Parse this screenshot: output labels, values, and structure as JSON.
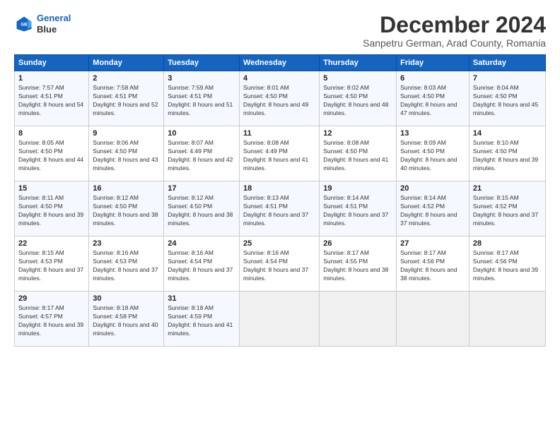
{
  "logo": {
    "line1": "General",
    "line2": "Blue"
  },
  "title": "December 2024",
  "subtitle": "Sanpetru German, Arad County, Romania",
  "headers": [
    "Sunday",
    "Monday",
    "Tuesday",
    "Wednesday",
    "Thursday",
    "Friday",
    "Saturday"
  ],
  "weeks": [
    [
      {
        "day": "1",
        "sunrise": "7:57 AM",
        "sunset": "4:51 PM",
        "daylight": "8 hours and 54 minutes."
      },
      {
        "day": "2",
        "sunrise": "7:58 AM",
        "sunset": "4:51 PM",
        "daylight": "8 hours and 52 minutes."
      },
      {
        "day": "3",
        "sunrise": "7:59 AM",
        "sunset": "4:51 PM",
        "daylight": "8 hours and 51 minutes."
      },
      {
        "day": "4",
        "sunrise": "8:01 AM",
        "sunset": "4:50 PM",
        "daylight": "8 hours and 49 minutes."
      },
      {
        "day": "5",
        "sunrise": "8:02 AM",
        "sunset": "4:50 PM",
        "daylight": "8 hours and 48 minutes."
      },
      {
        "day": "6",
        "sunrise": "8:03 AM",
        "sunset": "4:50 PM",
        "daylight": "8 hours and 47 minutes."
      },
      {
        "day": "7",
        "sunrise": "8:04 AM",
        "sunset": "4:50 PM",
        "daylight": "8 hours and 45 minutes."
      }
    ],
    [
      {
        "day": "8",
        "sunrise": "8:05 AM",
        "sunset": "4:50 PM",
        "daylight": "8 hours and 44 minutes."
      },
      {
        "day": "9",
        "sunrise": "8:06 AM",
        "sunset": "4:50 PM",
        "daylight": "8 hours and 43 minutes."
      },
      {
        "day": "10",
        "sunrise": "8:07 AM",
        "sunset": "4:49 PM",
        "daylight": "8 hours and 42 minutes."
      },
      {
        "day": "11",
        "sunrise": "8:08 AM",
        "sunset": "4:49 PM",
        "daylight": "8 hours and 41 minutes."
      },
      {
        "day": "12",
        "sunrise": "8:08 AM",
        "sunset": "4:50 PM",
        "daylight": "8 hours and 41 minutes."
      },
      {
        "day": "13",
        "sunrise": "8:09 AM",
        "sunset": "4:50 PM",
        "daylight": "8 hours and 40 minutes."
      },
      {
        "day": "14",
        "sunrise": "8:10 AM",
        "sunset": "4:50 PM",
        "daylight": "8 hours and 39 minutes."
      }
    ],
    [
      {
        "day": "15",
        "sunrise": "8:11 AM",
        "sunset": "4:50 PM",
        "daylight": "8 hours and 39 minutes."
      },
      {
        "day": "16",
        "sunrise": "8:12 AM",
        "sunset": "4:50 PM",
        "daylight": "8 hours and 38 minutes."
      },
      {
        "day": "17",
        "sunrise": "8:12 AM",
        "sunset": "4:50 PM",
        "daylight": "8 hours and 38 minutes."
      },
      {
        "day": "18",
        "sunrise": "8:13 AM",
        "sunset": "4:51 PM",
        "daylight": "8 hours and 37 minutes."
      },
      {
        "day": "19",
        "sunrise": "8:14 AM",
        "sunset": "4:51 PM",
        "daylight": "8 hours and 37 minutes."
      },
      {
        "day": "20",
        "sunrise": "8:14 AM",
        "sunset": "4:52 PM",
        "daylight": "8 hours and 37 minutes."
      },
      {
        "day": "21",
        "sunrise": "8:15 AM",
        "sunset": "4:52 PM",
        "daylight": "8 hours and 37 minutes."
      }
    ],
    [
      {
        "day": "22",
        "sunrise": "8:15 AM",
        "sunset": "4:53 PM",
        "daylight": "8 hours and 37 minutes."
      },
      {
        "day": "23",
        "sunrise": "8:16 AM",
        "sunset": "4:53 PM",
        "daylight": "8 hours and 37 minutes."
      },
      {
        "day": "24",
        "sunrise": "8:16 AM",
        "sunset": "4:54 PM",
        "daylight": "8 hours and 37 minutes."
      },
      {
        "day": "25",
        "sunrise": "8:16 AM",
        "sunset": "4:54 PM",
        "daylight": "8 hours and 37 minutes."
      },
      {
        "day": "26",
        "sunrise": "8:17 AM",
        "sunset": "4:55 PM",
        "daylight": "8 hours and 38 minutes."
      },
      {
        "day": "27",
        "sunrise": "8:17 AM",
        "sunset": "4:56 PM",
        "daylight": "8 hours and 38 minutes."
      },
      {
        "day": "28",
        "sunrise": "8:17 AM",
        "sunset": "4:56 PM",
        "daylight": "8 hours and 39 minutes."
      }
    ],
    [
      {
        "day": "29",
        "sunrise": "8:17 AM",
        "sunset": "4:57 PM",
        "daylight": "8 hours and 39 minutes."
      },
      {
        "day": "30",
        "sunrise": "8:18 AM",
        "sunset": "4:58 PM",
        "daylight": "8 hours and 40 minutes."
      },
      {
        "day": "31",
        "sunrise": "8:18 AM",
        "sunset": "4:59 PM",
        "daylight": "8 hours and 41 minutes."
      },
      null,
      null,
      null,
      null
    ]
  ]
}
